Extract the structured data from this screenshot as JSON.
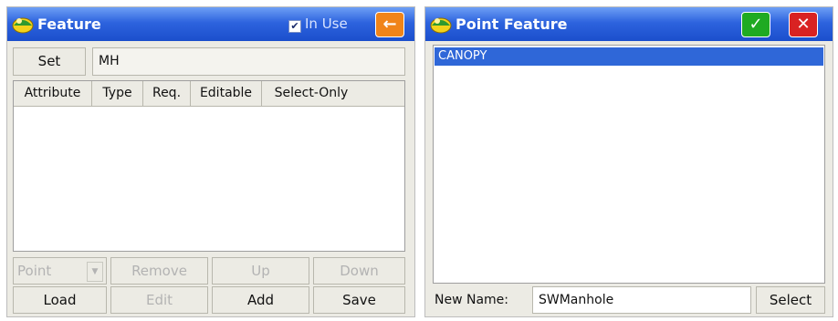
{
  "feature_dialog": {
    "title": "Feature",
    "in_use_label": "In Use",
    "in_use_checked": true,
    "set_label": "Set",
    "set_value": "MH",
    "columns": [
      "Attribute",
      "Type",
      "Req.",
      "Editable",
      "Select-Only"
    ],
    "type_select": "Point",
    "remove_label": "Remove",
    "up_label": "Up",
    "down_label": "Down",
    "load_label": "Load",
    "edit_label": "Edit",
    "add_label": "Add",
    "save_label": "Save",
    "back_icon": "arrow-left-icon"
  },
  "point_feature_dialog": {
    "title": "Point Feature",
    "list_items": [
      "CANOPY"
    ],
    "selected_index": 0,
    "new_name_label": "New Name:",
    "new_name_value": "SWManhole",
    "select_label": "Select",
    "ok_icon": "checkmark-icon",
    "close_icon": "close-icon"
  },
  "colors": {
    "titlebar": "#2d63de",
    "selection": "#2f67d8",
    "ok": "#1faa22",
    "close": "#d92222",
    "back": "#f08419"
  }
}
